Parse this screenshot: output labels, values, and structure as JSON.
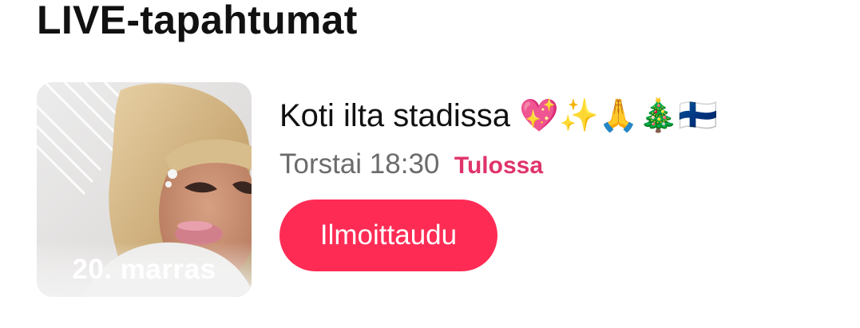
{
  "section": {
    "title": "LIVE-tapahtumat"
  },
  "event": {
    "thumbnail_date": "20. marras",
    "title": "Koti ilta stadissa 💖✨🙏🎄🇫🇮",
    "time": "Torstai 18:30",
    "status": "Tulossa",
    "register_label": "Ilmoittaudu"
  },
  "colors": {
    "accent": "#fe2c55",
    "status": "#e0336a",
    "muted_text": "#6b6b6b"
  }
}
